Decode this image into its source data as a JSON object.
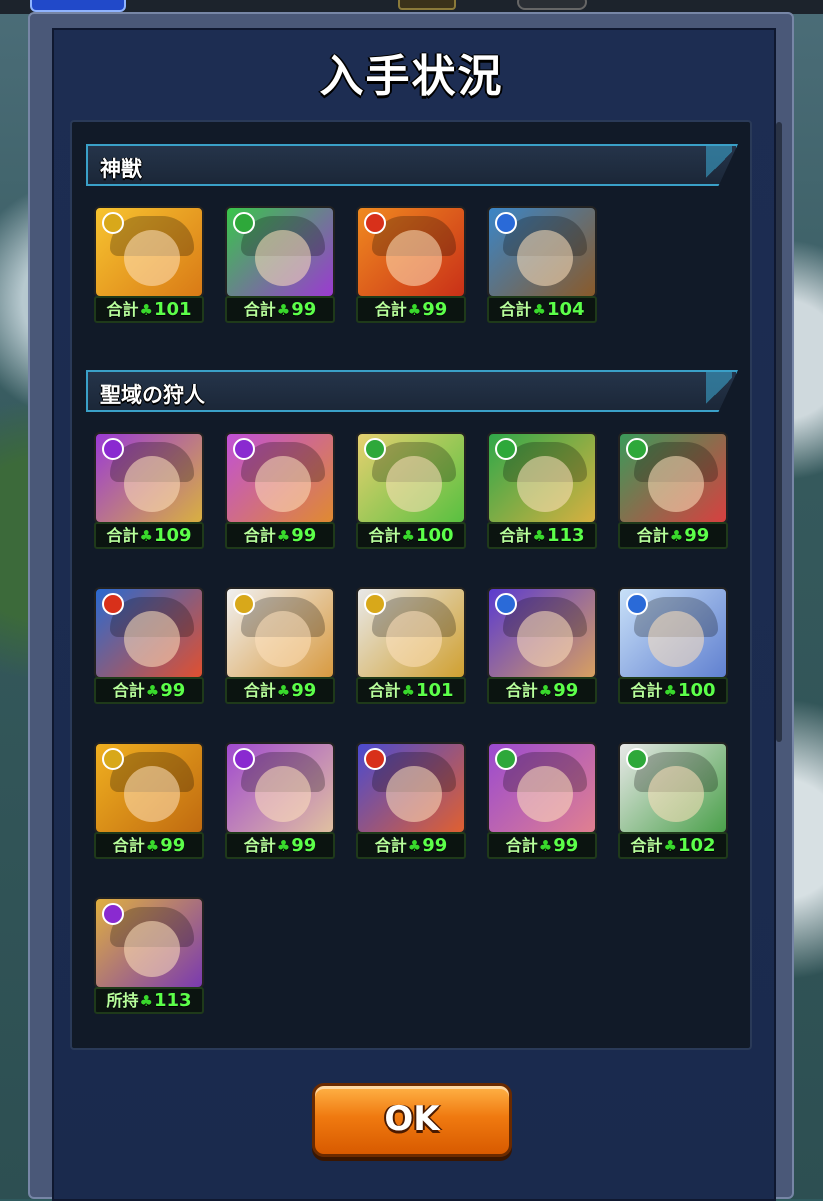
{
  "dialog": {
    "title": "入手状況",
    "ok_label": "OK"
  },
  "sections": [
    {
      "title": "神獣",
      "items": [
        {
          "prefix": "合計",
          "count": "101",
          "element": "light",
          "colors": [
            "#f7c430",
            "#d97a16"
          ]
        },
        {
          "prefix": "合計",
          "count": "99",
          "element": "wood",
          "colors": [
            "#38c64a",
            "#9b3ad1"
          ]
        },
        {
          "prefix": "合計",
          "count": "99",
          "element": "fire",
          "colors": [
            "#f08a20",
            "#c93018"
          ]
        },
        {
          "prefix": "合計",
          "count": "104",
          "element": "water",
          "colors": [
            "#3a86c8",
            "#8a5a2a"
          ]
        }
      ]
    },
    {
      "title": "聖域の狩人",
      "items": [
        {
          "prefix": "合計",
          "count": "109",
          "element": "dark",
          "colors": [
            "#9a3ad6",
            "#d9b040"
          ]
        },
        {
          "prefix": "合計",
          "count": "99",
          "element": "dark",
          "colors": [
            "#c050d8",
            "#e08a30"
          ]
        },
        {
          "prefix": "合計",
          "count": "100",
          "element": "wood",
          "colors": [
            "#e6d070",
            "#58c040"
          ]
        },
        {
          "prefix": "合計",
          "count": "113",
          "element": "wood",
          "colors": [
            "#2fa84a",
            "#d8b040"
          ]
        },
        {
          "prefix": "合計",
          "count": "99",
          "element": "wood",
          "colors": [
            "#3a9a5a",
            "#d84040"
          ]
        },
        {
          "prefix": "合計",
          "count": "99",
          "element": "fire",
          "colors": [
            "#2a6ad0",
            "#e05030"
          ]
        },
        {
          "prefix": "合計",
          "count": "99",
          "element": "light",
          "colors": [
            "#f0f0f0",
            "#d89a40"
          ]
        },
        {
          "prefix": "合計",
          "count": "101",
          "element": "light",
          "colors": [
            "#e8e8e8",
            "#d0a030"
          ]
        },
        {
          "prefix": "合計",
          "count": "99",
          "element": "water",
          "colors": [
            "#5a3ad0",
            "#d8a060"
          ]
        },
        {
          "prefix": "合計",
          "count": "100",
          "element": "water",
          "colors": [
            "#c8e0f8",
            "#6080d0"
          ]
        },
        {
          "prefix": "合計",
          "count": "99",
          "element": "light",
          "colors": [
            "#f0b020",
            "#c06a10"
          ]
        },
        {
          "prefix": "合計",
          "count": "99",
          "element": "dark",
          "colors": [
            "#a04ad0",
            "#e0c0a0"
          ]
        },
        {
          "prefix": "合計",
          "count": "99",
          "element": "fire",
          "colors": [
            "#4a4ad0",
            "#e06030"
          ]
        },
        {
          "prefix": "合計",
          "count": "99",
          "element": "wood",
          "colors": [
            "#9a4ad0",
            "#e08090"
          ]
        },
        {
          "prefix": "合計",
          "count": "102",
          "element": "wood",
          "colors": [
            "#e8e8e8",
            "#4aa04a"
          ]
        },
        {
          "prefix": "所持",
          "count": "113",
          "element": "dark",
          "colors": [
            "#e0b040",
            "#7a3ab0"
          ]
        }
      ]
    }
  ],
  "element_colors": {
    "light": "#d8a81a",
    "wood": "#2ea83a",
    "fire": "#d8301a",
    "water": "#2a6ad8",
    "dark": "#8a2ad0"
  }
}
